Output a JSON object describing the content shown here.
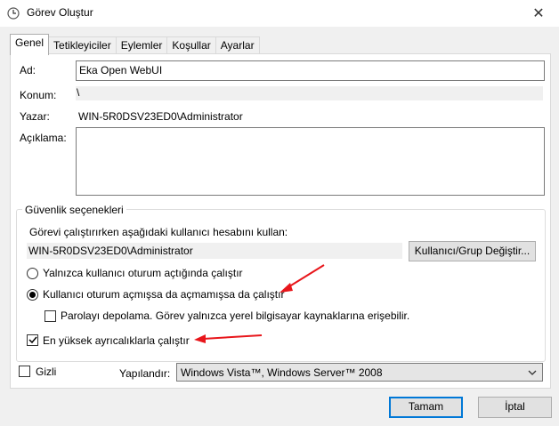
{
  "window": {
    "title": "Görev Oluştur",
    "close_glyph": "✕"
  },
  "tabs": [
    {
      "label": "Genel",
      "active": true
    },
    {
      "label": "Tetikleyiciler",
      "active": false
    },
    {
      "label": "Eylemler",
      "active": false
    },
    {
      "label": "Koşullar",
      "active": false
    },
    {
      "label": "Ayarlar",
      "active": false
    }
  ],
  "general": {
    "name_label": "Ad:",
    "name_value": "Eka Open WebUI",
    "location_label": "Konum:",
    "location_value": "\\",
    "author_label": "Yazar:",
    "author_value": "WIN-5R0DSV23ED0\\Administrator",
    "description_label": "Açıklama:",
    "description_value": ""
  },
  "security": {
    "group_title": "Güvenlik seçenekleri",
    "account_prompt": "Görevi çalıştırırken aşağıdaki kullanıcı hesabını kullan:",
    "account_value": "WIN-5R0DSV23ED0\\Administrator",
    "change_user_button": "Kullanıcı/Grup Değiştir...",
    "radio_logged_on": "Yalnızca kullanıcı oturum açtığında çalıştır",
    "radio_logged_on_selected": false,
    "radio_whether": "Kullanıcı oturum açmışsa da açmamışsa da çalıştır",
    "radio_whether_selected": true,
    "do_not_store_password": "Parolayı depolama. Görev yalnızca yerel bilgisayar kaynaklarına erişebilir.",
    "do_not_store_password_checked": false,
    "highest_privileges": "En yüksek ayrıcalıklarla çalıştır",
    "highest_privileges_checked": true
  },
  "bottom": {
    "hidden_label": "Gizli",
    "hidden_checked": false,
    "configure_label": "Yapılandır:",
    "configure_value": "Windows Vista™, Windows Server™ 2008"
  },
  "buttons": {
    "ok": "Tamam",
    "cancel": "İptal"
  },
  "colors": {
    "annotation_arrow": "#e8161b",
    "focus_border": "#0078d7"
  },
  "icons": {
    "title": "task-scheduler-clock-icon",
    "select_arrow": "chevron-down-icon",
    "check": "checkmark-icon"
  }
}
